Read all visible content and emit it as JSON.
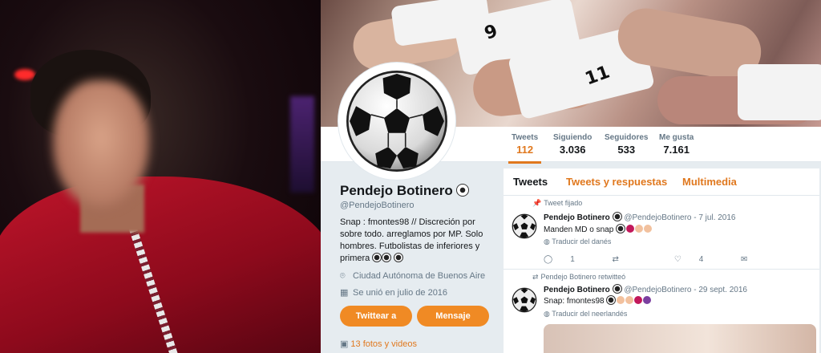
{
  "profile": {
    "name": "Pendejo Botinero",
    "handle": "@PendejoBotinero",
    "bio": "Snap : fmontes98 // Discreción por sobre todo. arreglamos por MP. Solo hombres. Futbolistas de inferiores y primera",
    "location": "Ciudad Autónoma de Buenos Aire",
    "joined": "Se unió en julio de 2016",
    "tweet_button": "Twittear a",
    "message_button": "Mensaje",
    "media_link": "13 fotos y videos"
  },
  "stats": [
    {
      "label": "Tweets",
      "value": "112"
    },
    {
      "label": "Siguiendo",
      "value": "3.036"
    },
    {
      "label": "Seguidores",
      "value": "533"
    },
    {
      "label": "Me gusta",
      "value": "7.161"
    }
  ],
  "tabs": [
    {
      "label": "Tweets"
    },
    {
      "label": "Tweets y respuestas"
    },
    {
      "label": "Multimedia"
    }
  ],
  "tweets": [
    {
      "context": "Tweet fijado",
      "name": "Pendejo Botinero",
      "meta": "@PendejoBotinero - 7 jul. 2016",
      "text": "Manden MD o snap",
      "translate": "Traducir del danés",
      "replies": "1",
      "retweets": "",
      "likes": "4"
    },
    {
      "context": "Pendejo Botinero  retwitteó",
      "name": "Pendejo Botinero",
      "meta": "@PendejoBotinero - 29 sept. 2016",
      "text": "Snap: fmontes98",
      "translate": "Traducir del neerlandés"
    }
  ],
  "banner": {
    "jersey_numbers": [
      "9",
      "11"
    ]
  },
  "colors": {
    "accent": "#e0781e",
    "button": "#f08a24",
    "shirt": "#c0152b"
  },
  "icons": [
    "soccer-ball-icon",
    "pin-icon",
    "location-icon",
    "calendar-icon",
    "photo-icon",
    "reply-icon",
    "retweet-icon",
    "like-icon",
    "message-icon"
  ]
}
